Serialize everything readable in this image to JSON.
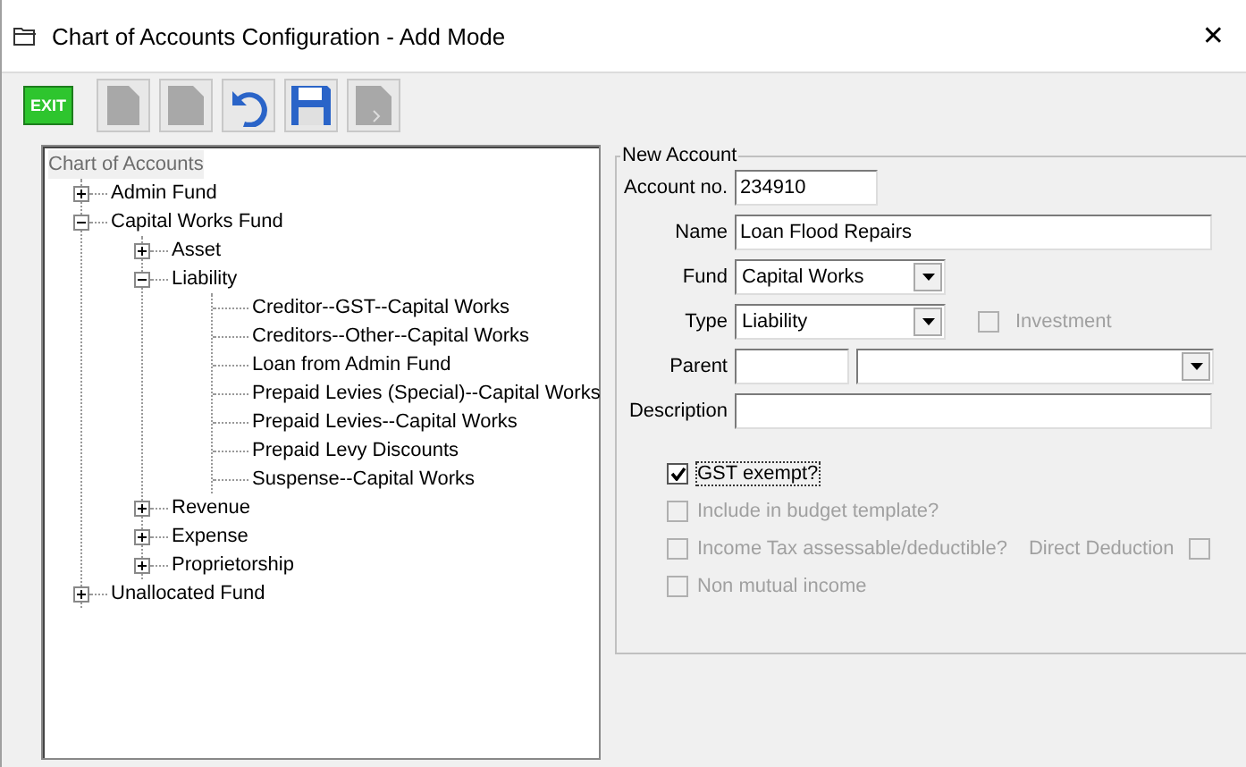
{
  "window": {
    "title": "Chart of Accounts Configuration - Add Mode",
    "close": "✕"
  },
  "toolbar": [
    {
      "kind": "exit",
      "label": "EXIT",
      "disabled": false
    },
    {
      "kind": "new",
      "disabled": true
    },
    {
      "kind": "copy",
      "disabled": true
    },
    {
      "kind": "undo",
      "disabled": false
    },
    {
      "kind": "save",
      "disabled": false
    },
    {
      "kind": "export",
      "disabled": true
    }
  ],
  "tree": {
    "root": "Chart of Accounts",
    "items": [
      {
        "label": "Admin Fund",
        "expanded": false
      },
      {
        "label": "Capital Works Fund",
        "expanded": true,
        "children": [
          {
            "label": "Asset",
            "expanded": false
          },
          {
            "label": "Liability",
            "expanded": true,
            "children": [
              {
                "label": "Creditor--GST--Capital Works"
              },
              {
                "label": "Creditors--Other--Capital Works"
              },
              {
                "label": "Loan from Admin Fund"
              },
              {
                "label": "Prepaid Levies (Special)--Capital Works"
              },
              {
                "label": "Prepaid Levies--Capital Works"
              },
              {
                "label": "Prepaid Levy Discounts"
              },
              {
                "label": "Suspense--Capital Works"
              }
            ]
          },
          {
            "label": "Revenue",
            "expanded": false
          },
          {
            "label": "Expense",
            "expanded": false
          },
          {
            "label": "Proprietorship",
            "expanded": false
          }
        ]
      },
      {
        "label": "Unallocated Fund",
        "expanded": false
      }
    ]
  },
  "form": {
    "legend": "New Account",
    "account_no": {
      "label": "Account no.",
      "value": "234910"
    },
    "name": {
      "label": "Name",
      "value": "Loan Flood Repairs"
    },
    "fund": {
      "label": "Fund",
      "value": "Capital Works"
    },
    "type": {
      "label": "Type",
      "value": "Liability"
    },
    "investment": {
      "label": "Investment",
      "checked": false,
      "disabled": true
    },
    "parent": {
      "label": "Parent"
    },
    "description": {
      "label": "Description"
    },
    "checkboxes": [
      {
        "label": "GST exempt?",
        "checked": true,
        "disabled": false,
        "focused": true
      },
      {
        "label": "Include in budget template?",
        "checked": false,
        "disabled": true,
        "focused": false
      },
      {
        "label": "Income Tax assessable/deductible?",
        "checked": false,
        "disabled": true,
        "focused": false,
        "side": {
          "label": "Direct Deduction",
          "checked": false,
          "disabled": true
        }
      },
      {
        "label": "Non mutual income",
        "checked": false,
        "disabled": true,
        "focused": false
      }
    ]
  }
}
